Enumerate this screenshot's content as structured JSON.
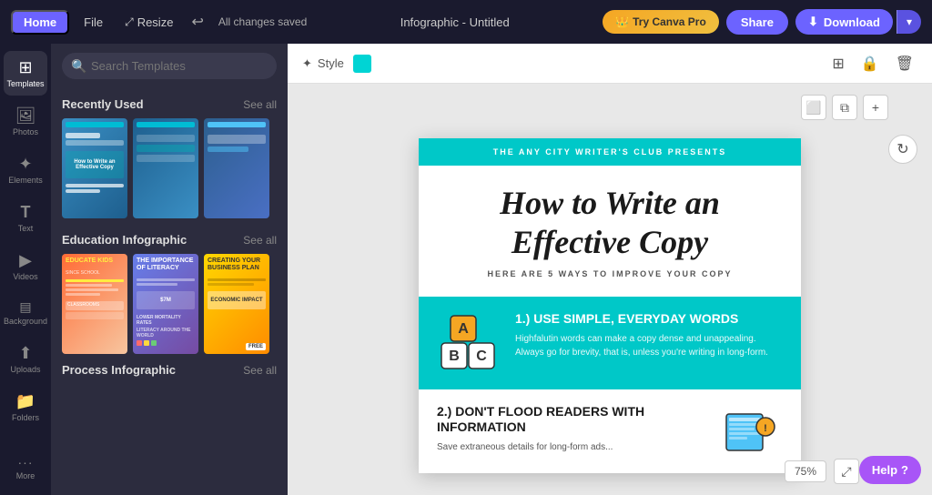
{
  "topbar": {
    "home_label": "Home",
    "file_label": "File",
    "resize_label": "Resize",
    "saved_label": "All changes saved",
    "title": "Infographic - Untitled",
    "try_pro_label": "Try Canva Pro",
    "share_label": "Share",
    "download_label": "Download",
    "crown_icon": "👑"
  },
  "sidebar": {
    "items": [
      {
        "id": "templates",
        "label": "Templates",
        "icon": "⊞"
      },
      {
        "id": "photos",
        "label": "Photos",
        "icon": "🖼"
      },
      {
        "id": "elements",
        "label": "Elements",
        "icon": "✦"
      },
      {
        "id": "text",
        "label": "Text",
        "icon": "T"
      },
      {
        "id": "videos",
        "label": "Videos",
        "icon": "▶"
      },
      {
        "id": "background",
        "label": "Background",
        "icon": "◻"
      },
      {
        "id": "uploads",
        "label": "Uploads",
        "icon": "⬆"
      },
      {
        "id": "folders",
        "label": "Folders",
        "icon": "📁"
      }
    ],
    "more_label": "More"
  },
  "template_panel": {
    "search_placeholder": "Search Templates",
    "recently_used_label": "Recently Used",
    "see_all_label": "See all",
    "education_label": "Education Infographic",
    "process_label": "Process Infographic",
    "edu_items": [
      {
        "title": "EDUCATE KIDS",
        "subtitle": "SINCE SCHOOL"
      },
      {
        "title": "THE IMPORTANCE OF LITERACY",
        "subtitle": ""
      },
      {
        "title": "CREATING YOUR BUSINESS PLAN",
        "subtitle": "",
        "free": true
      }
    ]
  },
  "toolbar": {
    "style_label": "Style",
    "style_color": "#00d4d4"
  },
  "canvas": {
    "refresh_icon": "↻",
    "add_icon": "+",
    "copy_icon": "⧉",
    "frame_icon": "⬜"
  },
  "document": {
    "header_text": "THE ANY CITY WRITER'S CLUB PRESENTS",
    "main_title": "How to Write an Effective Copy",
    "subtitle": "HERE ARE 5 WAYS TO IMPROVE YOUR COPY",
    "point1_title": "1.) USE SIMPLE, EVERYDAY WORDS",
    "point1_body": "Highfalutin words can make a copy dense and unappealing. Always go for brevity, that is, unless you're writing in long-form.",
    "point2_title": "2.) DON'T FLOOD READERS WITH INFORMATION",
    "point2_body": "Save extraneous details for long-form ads..."
  },
  "bottom": {
    "zoom_label": "75%",
    "expand_icon": "⤢",
    "help_label": "Help",
    "help_icon": "?"
  }
}
